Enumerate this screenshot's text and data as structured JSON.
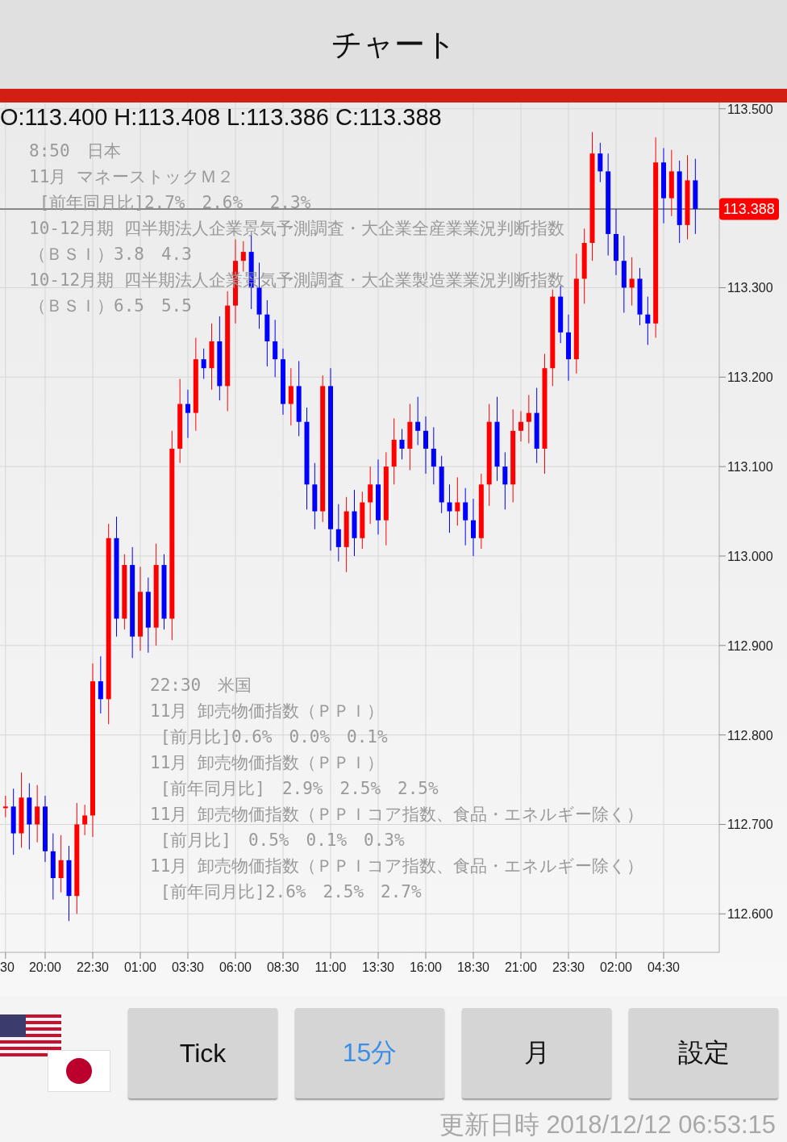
{
  "header": {
    "title": "チャート"
  },
  "chart": {
    "ohlc_text": "O:113.400 H:113.408 L:113.386 C:113.388",
    "chart_data": {
      "type": "candlestick",
      "ylim": [
        112.557,
        113.507
      ],
      "grid": true,
      "ref_lines": [
        {
          "axis": "y",
          "value": 113.388,
          "label": "113.388"
        }
      ],
      "categories": [
        "30",
        null,
        null,
        null,
        null,
        "20:00",
        null,
        null,
        null,
        null,
        null,
        "22:30",
        null,
        null,
        null,
        null,
        null,
        "01:00",
        null,
        null,
        null,
        null,
        null,
        "03:30",
        null,
        null,
        null,
        null,
        null,
        "06:00",
        null,
        null,
        null,
        null,
        null,
        "08:30",
        null,
        null,
        null,
        null,
        null,
        "11:00",
        null,
        null,
        null,
        null,
        null,
        "13:30",
        null,
        null,
        null,
        null,
        null,
        "16:00",
        null,
        null,
        null,
        null,
        null,
        "18:30",
        null,
        null,
        null,
        null,
        null,
        "21:00",
        null,
        null,
        null,
        null,
        null,
        "23:30",
        null,
        null,
        null,
        null,
        null,
        "02:00",
        null,
        null,
        null,
        null,
        null,
        "04:30",
        null,
        null,
        null,
        null
      ],
      "ohlc": [
        [
          112.72,
          112.732,
          112.708,
          112.72
        ],
        [
          112.72,
          112.74,
          112.666,
          112.69
        ],
        [
          112.69,
          112.758,
          112.674,
          112.73
        ],
        [
          112.73,
          112.746,
          112.672,
          112.7
        ],
        [
          112.7,
          112.744,
          112.68,
          112.72
        ],
        [
          112.72,
          112.732,
          112.658,
          112.67
        ],
        [
          112.67,
          112.69,
          112.616,
          112.64
        ],
        [
          112.64,
          112.688,
          112.624,
          112.66
        ],
        [
          112.66,
          112.676,
          112.592,
          112.62
        ],
        [
          112.62,
          112.724,
          112.6,
          112.7
        ],
        [
          112.7,
          112.722,
          112.688,
          112.71
        ],
        [
          112.71,
          112.88,
          112.686,
          112.86
        ],
        [
          112.86,
          112.888,
          112.824,
          112.84
        ],
        [
          112.84,
          113.036,
          112.812,
          113.02
        ],
        [
          113.02,
          113.044,
          112.91,
          112.93
        ],
        [
          112.93,
          113.002,
          112.918,
          112.99
        ],
        [
          112.99,
          113.01,
          112.886,
          112.91
        ],
        [
          112.91,
          112.988,
          112.894,
          112.96
        ],
        [
          112.96,
          112.976,
          112.892,
          112.92
        ],
        [
          112.92,
          113.014,
          112.9,
          112.99
        ],
        [
          112.99,
          113.002,
          112.918,
          112.93
        ],
        [
          112.93,
          113.14,
          112.906,
          113.12
        ],
        [
          113.12,
          113.198,
          113.104,
          113.17
        ],
        [
          113.17,
          113.186,
          113.132,
          113.16
        ],
        [
          113.16,
          113.244,
          113.14,
          113.22
        ],
        [
          113.22,
          113.232,
          113.198,
          113.21
        ],
        [
          113.21,
          113.26,
          113.186,
          113.24
        ],
        [
          113.24,
          113.268,
          113.174,
          113.19
        ],
        [
          113.19,
          113.296,
          113.162,
          113.28
        ],
        [
          113.28,
          113.354,
          113.26,
          113.33
        ],
        [
          113.33,
          113.352,
          113.318,
          113.34
        ],
        [
          113.34,
          113.36,
          113.276,
          113.3
        ],
        [
          113.3,
          113.328,
          113.254,
          113.27
        ],
        [
          113.27,
          113.286,
          113.212,
          113.24
        ],
        [
          113.24,
          113.264,
          113.2,
          113.22
        ],
        [
          113.22,
          113.232,
          113.158,
          113.17
        ],
        [
          113.17,
          113.21,
          113.146,
          113.19
        ],
        [
          113.19,
          113.218,
          113.134,
          113.15
        ],
        [
          113.15,
          113.166,
          113.052,
          113.08
        ],
        [
          113.08,
          113.104,
          113.03,
          113.05
        ],
        [
          113.05,
          113.202,
          113.038,
          113.19
        ],
        [
          113.19,
          113.21,
          113.006,
          113.03
        ],
        [
          113.03,
          113.058,
          112.994,
          113.01
        ],
        [
          113.01,
          113.066,
          112.982,
          113.05
        ],
        [
          113.05,
          113.074,
          113.0,
          113.02
        ],
        [
          113.02,
          113.072,
          113.008,
          113.06
        ],
        [
          113.06,
          113.1,
          113.036,
          113.08
        ],
        [
          113.08,
          113.108,
          113.024,
          113.04
        ],
        [
          113.04,
          113.116,
          113.012,
          113.1
        ],
        [
          113.1,
          113.154,
          113.08,
          113.13
        ],
        [
          113.13,
          113.142,
          113.108,
          113.12
        ],
        [
          113.12,
          113.17,
          113.096,
          113.15
        ],
        [
          113.15,
          113.178,
          113.124,
          113.14
        ],
        [
          113.14,
          113.156,
          113.092,
          113.12
        ],
        [
          113.12,
          113.144,
          113.08,
          113.1
        ],
        [
          113.1,
          113.112,
          113.048,
          113.06
        ],
        [
          113.06,
          113.08,
          113.026,
          113.05
        ],
        [
          113.05,
          113.088,
          113.034,
          113.06
        ],
        [
          113.06,
          113.076,
          113.012,
          113.04
        ],
        [
          113.04,
          113.064,
          113.0,
          113.02
        ],
        [
          113.02,
          113.092,
          113.008,
          113.08
        ],
        [
          113.08,
          113.17,
          113.056,
          113.15
        ],
        [
          113.15,
          113.178,
          113.084,
          113.1
        ],
        [
          113.1,
          113.116,
          113.052,
          113.08
        ],
        [
          113.08,
          113.164,
          113.06,
          113.14
        ],
        [
          113.14,
          113.162,
          113.128,
          113.15
        ],
        [
          113.15,
          113.18,
          113.126,
          113.16
        ],
        [
          113.16,
          113.188,
          113.104,
          113.12
        ],
        [
          113.12,
          113.226,
          113.092,
          113.21
        ],
        [
          113.21,
          113.298,
          113.19,
          113.29
        ],
        [
          113.29,
          113.302,
          113.238,
          113.25
        ],
        [
          113.25,
          113.27,
          113.196,
          113.22
        ],
        [
          113.22,
          113.338,
          113.204,
          113.31
        ],
        [
          113.31,
          113.366,
          113.282,
          113.35
        ],
        [
          113.35,
          113.474,
          113.33,
          113.45
        ],
        [
          113.45,
          113.462,
          113.418,
          113.43
        ],
        [
          113.43,
          113.45,
          113.336,
          113.36
        ],
        [
          113.36,
          113.388,
          113.314,
          113.33
        ],
        [
          113.33,
          113.358,
          113.272,
          113.3
        ],
        [
          113.3,
          113.334,
          113.28,
          113.31
        ],
        [
          113.31,
          113.322,
          113.258,
          113.27
        ],
        [
          113.27,
          113.29,
          113.236,
          113.26
        ],
        [
          113.26,
          113.468,
          113.244,
          113.44
        ],
        [
          113.44,
          113.456,
          113.372,
          113.4
        ],
        [
          113.4,
          113.454,
          113.38,
          113.43
        ],
        [
          113.43,
          113.442,
          113.35,
          113.37
        ],
        [
          113.37,
          113.448,
          113.354,
          113.42
        ],
        [
          113.42,
          113.444,
          113.36,
          113.388
        ]
      ],
      "yticks": [
        {
          "value": 113.5,
          "label": "113.500"
        },
        {
          "value": 113.3,
          "label": "113.300"
        },
        {
          "value": 113.2,
          "label": "113.200"
        },
        {
          "value": 113.1,
          "label": "113.100"
        },
        {
          "value": 113.0,
          "label": "113.000"
        },
        {
          "value": 112.9,
          "label": "112.900"
        },
        {
          "value": 112.8,
          "label": "112.800"
        },
        {
          "value": 112.7,
          "label": "112.700"
        },
        {
          "value": 112.6,
          "label": "112.600"
        }
      ]
    },
    "events": [
      {
        "lines": [
          "8:50　日本",
          "11月 マネーストックＭ２",
          " [前年同月比]2.7%　2.6%　 2.3%",
          "10-12月期 四半期法人企業景気予測調査・大企業全産業業況判断指数",
          "（ＢＳＩ）3.8　4.3",
          "10-12月期 四半期法人企業景気予測調査・大企業製造業業況判断指数",
          "（ＢＳＩ）6.5　5.5"
        ]
      },
      {
        "lines": [
          "22:30　米国",
          "11月 卸売物価指数（ＰＰＩ）",
          " [前月比]0.6%　0.0%　0.1%",
          "11月 卸売物価指数（ＰＰＩ）",
          " [前年同月比]　2.9%　2.5%　2.5%",
          "11月 卸売物価指数（ＰＰＩコア指数、食品・エネルギー除く）",
          " [前月比]　0.5%　0.1%　0.3%",
          "11月 卸売物価指数（ＰＰＩコア指数、食品・エネルギー除く）",
          " [前年同月比]2.6%　2.5%　2.7%"
        ]
      }
    ]
  },
  "periods": [
    {
      "label": "Tick",
      "selected": false
    },
    {
      "label": "15分",
      "selected": true
    },
    {
      "label": "月",
      "selected": false
    },
    {
      "label": "設定",
      "selected": false
    }
  ],
  "updated": "更新日時 2018/12/12 06:53:15"
}
